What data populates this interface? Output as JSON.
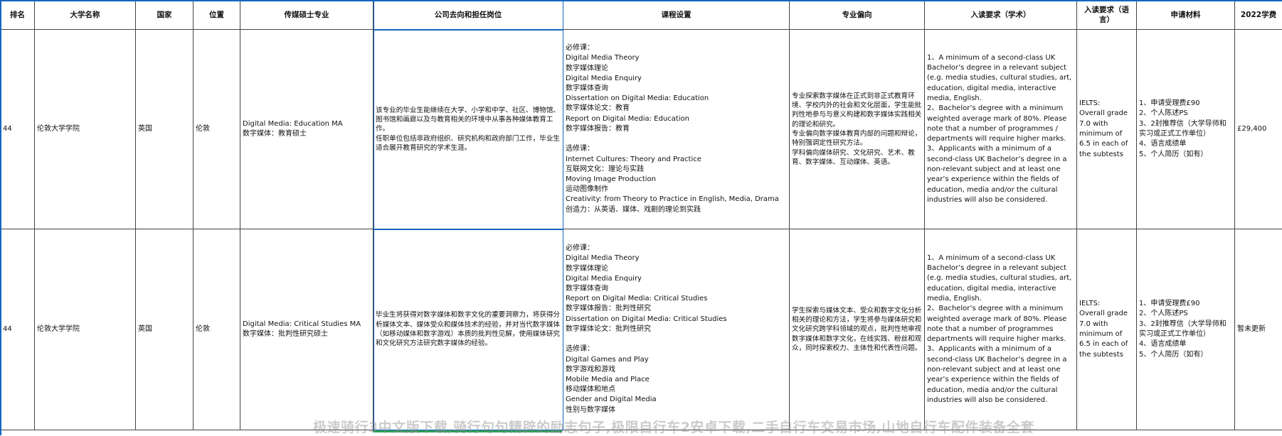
{
  "headers": [
    "排名",
    "大学名称",
    "国家",
    "位置",
    "传媒硕士专业",
    "公司去向和担任岗位",
    "课程设置",
    "专业偏向",
    "入读要求（学术）",
    "入读要求（语言）",
    "申请材料",
    "2022学费"
  ],
  "rows": [
    {
      "rank": "44",
      "university": "伦敦大学学院",
      "country": "英国",
      "location": "伦敦",
      "program": "Digital Media: Education MA\n数字媒体：教育硕士",
      "career": "该专业的毕业生能继续在大学、小学和中学、社区、博物馆、图书馆和画廊以及与教育相关的环境中从事各种媒体教育工作。\n任职单位包括非政府组织、研究机构和政府部门工作，毕业生适合展开教育研究的学术生涯。",
      "courses": "必修课：\nDigital Media Theory\n数字媒体理论\nDigital Media Enquiry\n数字媒体查询\nDissertation on Digital Media: Education\n数字媒体论文：教育\nReport on Digital Media: Education\n数字媒体报告：教育\n\n选修课：\nInternet Cultures: Theory and Practice\n互联网文化：理论与实践\nMoving Image Production\n运动图像制作\nCreativity: from Theory to Practice in English, Media, Drama\n创造力：从英语、媒体、戏剧的理论到实践",
      "focus": "专业探索数字媒体在正式到非正式教育环境、学校内外的社会和文化层面，学生能批判性地参与与意义构建和数字媒体实践相关的理论和研究。\n专业偏向数字媒体教育内部的问题和辩论，特别强调定性研究方法。\n学科偏向媒体研究、文化研究、艺术、教育、数字媒体、互动媒体、英语。",
      "academic": "1、A minimum of a second-class UK Bachelor’s degree in a relevant subject (e.g. media studies, cultural studies, art, education, digital media, interactive media, English.\n2、Bachelor’s degree with a minimum weighted average mark of 80%. Please note that a number of programmes / departments will require higher marks.\n3、Applicants with a minimum of a second-class UK Bachelor’s degree in a non-relevant subject and at least one year’s experience within the fields of education, media and/or the cultural industries will also be considered.",
      "language": "IELTS:\nOverall grade 7.0 with minimum of 6.5 in each of the subtests",
      "materials": "1、申请受理费£90\n2、个人陈述PS\n3、2封推荐信（大学导师和实习或正式工作单位）\n4、语言成绩单\n5、个人简历（如有）",
      "tuition": "£29,400"
    },
    {
      "rank": "44",
      "university": "伦敦大学学院",
      "country": "英国",
      "location": "伦敦",
      "program": "Digital Media: Critical Studies MA\n数字媒体：批判性研究硕士",
      "career": "毕业生将获得对数字媒体和数字文化的重要洞察力，将获得分析媒体文本、媒体受众和媒体技术的经验，并对当代数字媒体（如移动媒体和数字游戏）本质的批判性见解，使用媒体研究和文化研究方法研究数字媒体的经验。",
      "courses": "必修课：\nDigital Media Theory\n数字媒体理论\nDigital Media Enquiry\n数字媒体查询\nReport on Digital Media: Critical Studies\n数字媒体报告：批判性研究\nDissertation on Digital Media: Critical Studies\n数字媒体论文：批判性研究\n\n选修课：\nDigital Games and Play\n数字游戏和游戏\nMobile Media and Place\n移动媒体和地点\nGender and Digital Media\n性别与数字媒体",
      "focus": "学生探索与媒体文本、受众和数字文化分析相关的理论和方法，学生将参与媒体研究和文化研究跨学科领域的观点，批判性地审视数字媒体和数字文化，在线实践、粉丝和观众，同时探索权力、主体性和代表性问题。",
      "academic": "1、A minimum of a second-class UK Bachelor’s degree in a relevant subject (e.g. media studies, cultural studies, art, education, digital media, interactive media, English.\n2、Bachelor’s degree with a minimum weighted average mark of 80%. Please note that a number of programmes departments will require higher marks.\n3、Applicants with a minimum of a second-class UK Bachelor’s degree in a non-relevant subject and at least one year’s experience within the fields of education, media and/or the cultural industries will also be considered.",
      "language": "IELTS:\nOverall grade 7.0 with minimum of 6.5 in each of the subtests",
      "materials": "1、申请受理费£90\n2、个人陈述PS\n3、2封推荐信（大学导师和实习或正式工作单位）\n4、语言成绩单\n5、个人简历（如有）",
      "tuition": "暂未更新"
    }
  ],
  "watermark": "极速骑行3中文版下载,骑行句句精辟的励志句子,极限自行车2安卓下载,二手自行车交易市场,山地自行车配件装备全套",
  "colors": {
    "selection": "#1565c0",
    "grid": "#444444",
    "watermark": "#8c8c8c"
  }
}
